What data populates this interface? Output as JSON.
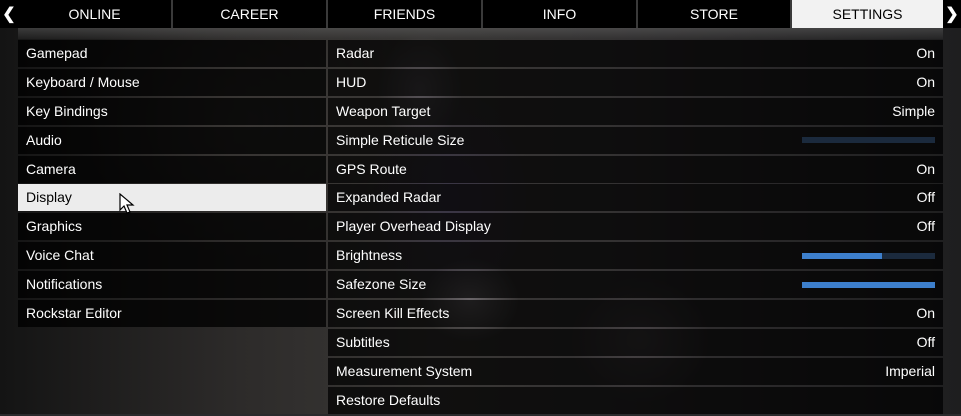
{
  "nav": {
    "tabs": [
      {
        "label": "ONLINE"
      },
      {
        "label": "CAREER"
      },
      {
        "label": "FRIENDS"
      },
      {
        "label": "INFO"
      },
      {
        "label": "STORE"
      },
      {
        "label": "SETTINGS"
      }
    ],
    "active_tab": "SETTINGS",
    "left_arrow_icon": "chevron-left-icon",
    "right_arrow_icon": "chevron-right-icon"
  },
  "menu": {
    "active": "Display",
    "items": [
      {
        "label": "Gamepad"
      },
      {
        "label": "Keyboard / Mouse"
      },
      {
        "label": "Key Bindings"
      },
      {
        "label": "Audio"
      },
      {
        "label": "Camera"
      },
      {
        "label": "Display"
      },
      {
        "label": "Graphics"
      },
      {
        "label": "Voice Chat"
      },
      {
        "label": "Notifications"
      },
      {
        "label": "Rockstar Editor"
      }
    ]
  },
  "settings": {
    "rows": [
      {
        "label": "Radar",
        "value": "On"
      },
      {
        "label": "HUD",
        "value": "On"
      },
      {
        "label": "Weapon Target",
        "value": "Simple"
      },
      {
        "label": "Simple Reticule Size",
        "slider": 0.0
      },
      {
        "label": "GPS Route",
        "value": "On"
      },
      {
        "label": "Expanded Radar",
        "value": "Off"
      },
      {
        "label": "Player Overhead Display",
        "value": "Off"
      },
      {
        "label": "Brightness",
        "slider": 0.6
      },
      {
        "label": "Safezone Size",
        "slider": 1.0
      },
      {
        "label": "Screen Kill Effects",
        "value": "On"
      },
      {
        "label": "Subtitles",
        "value": "Off"
      },
      {
        "label": "Measurement System",
        "value": "Imperial"
      },
      {
        "label": "Restore Defaults"
      }
    ]
  },
  "colors": {
    "slider_fill": "#3d7fcc",
    "slider_track": "#1b2a3d",
    "active_tab_bg": "#f2f2f2"
  }
}
